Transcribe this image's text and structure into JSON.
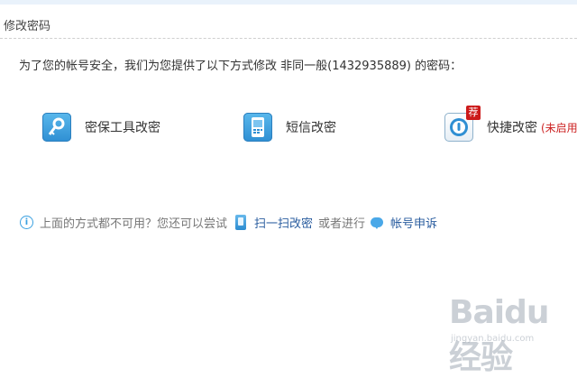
{
  "page": {
    "title": "修改密码"
  },
  "intro": {
    "text": "为了您的帐号安全，我们为您提供了以下方式修改 非同一般(1432935889) 的密码："
  },
  "methods": [
    {
      "label": "密保工具改密",
      "icon": "key-icon"
    },
    {
      "label": "短信改密",
      "icon": "sms-phone-icon"
    },
    {
      "label": "快捷改密",
      "icon": "lock-icon",
      "badge": "荐",
      "status": "(未启用"
    }
  ],
  "help": {
    "text": "上面的方式都不可用？您还可以尝试",
    "scan_link": "扫一扫改密",
    "or_text": "或者进行",
    "appeal_link": "帐号申诉"
  },
  "watermark": {
    "brand": "Baidu经验",
    "sub": "jingyan.baidu.com"
  },
  "colors": {
    "accent": "#2f8fd3",
    "link": "#2a5d9f",
    "status_red": "#cc2222",
    "badge_red": "#cc1a1a"
  }
}
